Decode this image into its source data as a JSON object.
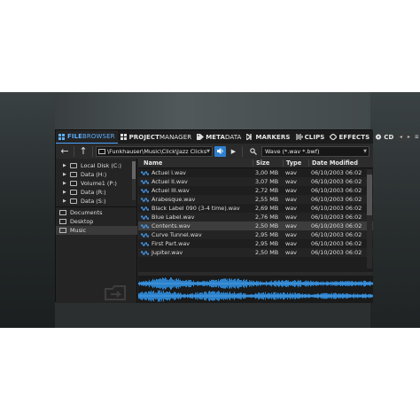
{
  "tabs": [
    {
      "label": "FILE",
      "label2": "BROWSER",
      "icon": "grid-icon",
      "active": true
    },
    {
      "label": "PROJECT",
      "label2": "MANAGER",
      "icon": "grid-icon",
      "active": false
    },
    {
      "label": "META",
      "label2": "DATA",
      "icon": "tag-icon",
      "active": false
    },
    {
      "label": "MARKERS",
      "label2": "",
      "icon": "marker-icon",
      "active": false
    },
    {
      "label": "CLIPS",
      "label2": "",
      "icon": "clips-icon",
      "active": false
    },
    {
      "label": "EFFECTS",
      "label2": "",
      "icon": "effects-icon",
      "active": false
    },
    {
      "label": "CD",
      "label2": "",
      "icon": "cd-icon",
      "active": false
    }
  ],
  "toolbar": {
    "path": "\\Funkhauser\\Music\\Click\\Jazz Clicks",
    "filter": "Wave (*.wav *.bwf)"
  },
  "drives": [
    {
      "label": "Local Disk (C:)"
    },
    {
      "label": "Data (H:)"
    },
    {
      "label": "Volume1 (P:)"
    },
    {
      "label": "Data (R:)"
    },
    {
      "label": "Data (S:)"
    }
  ],
  "places": [
    {
      "label": "Documents",
      "selected": false
    },
    {
      "label": "Desktop",
      "selected": false
    },
    {
      "label": "Music",
      "selected": true
    }
  ],
  "columns": {
    "name": "Name",
    "size": "Size",
    "type": "Type",
    "date": "Date Modified"
  },
  "files": [
    {
      "name": "Actuel I.wav",
      "size": "3,00 MB",
      "type": "wav",
      "date": "06/10/2003 06:02"
    },
    {
      "name": "Actuel II.wav",
      "size": "3,07 MB",
      "type": "wav",
      "date": "06/10/2003 06:02"
    },
    {
      "name": "Actuel III.wav",
      "size": "2,72 MB",
      "type": "wav",
      "date": "06/10/2003 06:02"
    },
    {
      "name": "Arabesque.wav",
      "size": "2,55 MB",
      "type": "wav",
      "date": "06/10/2003 06:02"
    },
    {
      "name": "Black Label 090 (3-4 time).wav",
      "size": "2,69 MB",
      "type": "wav",
      "date": "06/10/2003 06:02"
    },
    {
      "name": "Blue Label.wav",
      "size": "2,76 MB",
      "type": "wav",
      "date": "06/10/2003 06:02"
    },
    {
      "name": "Contents.wav",
      "size": "2,50 MB",
      "type": "wav",
      "date": "06/10/2003 06:02",
      "selected": true
    },
    {
      "name": "Curve Tunnel.wav",
      "size": "2,95 MB",
      "type": "wav",
      "date": "06/10/2003 06:02"
    },
    {
      "name": "First Part.wav",
      "size": "2,95 MB",
      "type": "wav",
      "date": "06/10/2003 06:02"
    },
    {
      "name": "Jupiter.wav",
      "size": "2,50 MB",
      "type": "wav",
      "date": "06/10/2003 06:02"
    }
  ],
  "colors": {
    "accent": "#4aa3ff",
    "waveform": "#2f8fe0",
    "background": "#262626"
  }
}
